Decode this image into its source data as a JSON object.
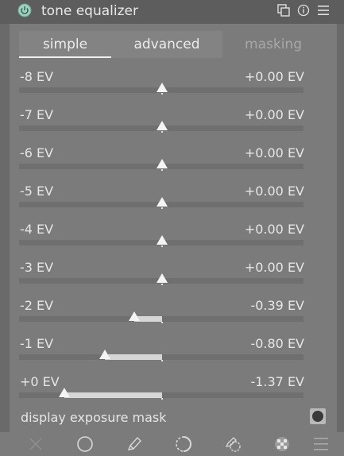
{
  "header": {
    "title": "tone equalizer"
  },
  "tabs": [
    {
      "label": "simple",
      "active": true
    },
    {
      "label": "advanced",
      "active": false
    },
    {
      "label": "masking",
      "active": false
    }
  ],
  "sliders": [
    {
      "label": "-8 EV",
      "value": "+0.00 EV",
      "ev": 0.0
    },
    {
      "label": "-7 EV",
      "value": "+0.00 EV",
      "ev": 0.0
    },
    {
      "label": "-6 EV",
      "value": "+0.00 EV",
      "ev": 0.0
    },
    {
      "label": "-5 EV",
      "value": "+0.00 EV",
      "ev": 0.0
    },
    {
      "label": "-4 EV",
      "value": "+0.00 EV",
      "ev": 0.0
    },
    {
      "label": "-3 EV",
      "value": "+0.00 EV",
      "ev": 0.0
    },
    {
      "label": "-2 EV",
      "value": "-0.39 EV",
      "ev": -0.39
    },
    {
      "label": "-1 EV",
      "value": "-0.80 EV",
      "ev": -0.8
    },
    {
      "label": "+0 EV",
      "value": "-1.37 EV",
      "ev": -1.37
    }
  ],
  "display_mask": {
    "label": "display exposure mask"
  },
  "icons": {
    "header": [
      "power-icon",
      "presets-icon",
      "reset-icon",
      "menu-icon"
    ],
    "bottom": [
      "close-icon",
      "circle-icon",
      "pencil-icon",
      "gradient-icon",
      "drawn-parametric-icon",
      "raster-mask-icon",
      "menu-icon"
    ]
  },
  "colors": {
    "accent": "#7fb8a6",
    "track": "#6f6f6f",
    "fill": "#d6d6d6"
  }
}
